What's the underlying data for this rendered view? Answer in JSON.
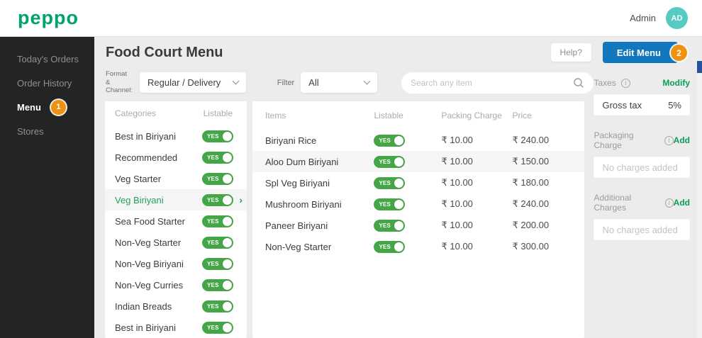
{
  "header": {
    "logo": "peppo",
    "user_label": "Admin",
    "avatar_initials": "AD"
  },
  "sidebar": {
    "items": [
      {
        "label": "Today's Orders",
        "active": false,
        "badge": null
      },
      {
        "label": "Order History",
        "active": false,
        "badge": null
      },
      {
        "label": "Menu",
        "active": true,
        "badge": "1"
      },
      {
        "label": "Stores",
        "active": false,
        "badge": null
      }
    ]
  },
  "page": {
    "title": "Food Court Menu",
    "help_label": "Help?",
    "edit_menu_label": "Edit Menu",
    "edit_menu_badge": "2"
  },
  "filters": {
    "format_channel_label_line1": "Format &",
    "format_channel_label_line2": "Channel:",
    "format_channel_value": "Regular / Delivery",
    "filter_label": "Filter",
    "filter_value": "All",
    "search_placeholder": "Search any item"
  },
  "categories": {
    "header": "Categories",
    "listable_header": "Listable",
    "toggle_label": "YES",
    "items": [
      {
        "name": "Best in Biriyani",
        "selected": false
      },
      {
        "name": "Recommended",
        "selected": false
      },
      {
        "name": "Veg Starter",
        "selected": false
      },
      {
        "name": "Veg Biriyani",
        "selected": true
      },
      {
        "name": "Sea Food Starter",
        "selected": false
      },
      {
        "name": "Non-Veg Starter",
        "selected": false
      },
      {
        "name": "Non-Veg Biriyani",
        "selected": false
      },
      {
        "name": "Non-Veg  Curries",
        "selected": false
      },
      {
        "name": "Indian Breads",
        "selected": false
      },
      {
        "name": "Best in Biriyani",
        "selected": false
      }
    ]
  },
  "items_table": {
    "headers": {
      "items": "Items",
      "listable": "Listable",
      "packing": "Packing Charge",
      "price": "Price"
    },
    "toggle_label": "YES",
    "rows": [
      {
        "name": "Biriyani Rice",
        "packing": "₹ 10.00",
        "price": "₹ 240.00",
        "highlight": false
      },
      {
        "name": "Aloo Dum Biriyani",
        "packing": "₹ 10.00",
        "price": "₹ 150.00",
        "highlight": true
      },
      {
        "name": "Spl Veg Biriyani",
        "packing": "₹ 10.00",
        "price": "₹ 180.00",
        "highlight": false
      },
      {
        "name": "Mushroom Biriyani",
        "packing": "₹ 10.00",
        "price": "₹ 240.00",
        "highlight": false
      },
      {
        "name": "Paneer Biriyani",
        "packing": "₹ 10.00",
        "price": "₹ 200.00",
        "highlight": false
      },
      {
        "name": "Non-Veg Starter",
        "packing": "₹ 10.00",
        "price": "₹ 300.00",
        "highlight": false
      }
    ]
  },
  "summary": {
    "taxes": {
      "label": "Taxes",
      "action": "Modify",
      "row_label": "Gross tax",
      "row_value": "5%"
    },
    "packaging": {
      "label": "Packaging Charge",
      "action": "Add",
      "empty": "No charges added"
    },
    "additional": {
      "label": "Additional Charges",
      "action": "Add",
      "empty": "No charges added"
    }
  },
  "colors": {
    "brand_green": "#00a26e",
    "toggle_green": "#45a648",
    "link_green": "#0c9d58",
    "accent_orange": "#ef9211",
    "primary_blue": "#1377bd",
    "avatar_teal": "#55cbc4",
    "sidebar_dark": "#242424"
  }
}
